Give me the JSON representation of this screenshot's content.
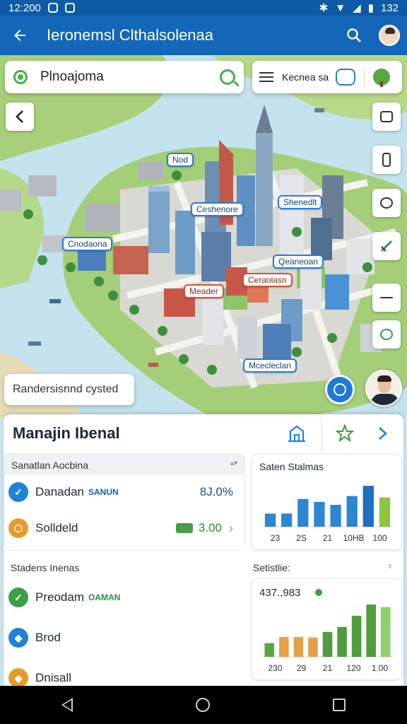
{
  "status_bar": {
    "time": "12:200",
    "battery": "132"
  },
  "app_bar": {
    "title": "Ieronemsl Clthalsolenaa"
  },
  "search": {
    "value": "Plnoajoma"
  },
  "filter": {
    "label": "Kecnea sa"
  },
  "map_labels": [
    "Nod",
    "Ceshenore",
    "Shenedlt",
    "Cnodaona",
    "Qeaneoan",
    "Ceraolasn",
    "Meader",
    "Mcecleclan"
  ],
  "toast": "Randersisnnd cysted",
  "panel": {
    "title": "Manajin Ibenal",
    "section1": {
      "header": "Sanatlan Aocbina",
      "rows": [
        {
          "name": "Danadan",
          "tag": "SANUN",
          "value": "8J.0%"
        },
        {
          "name": "Solldeld",
          "value": "3.00"
        }
      ]
    },
    "section2": {
      "header": "Stadens Inenas",
      "rows": [
        {
          "name": "Preodam",
          "tag": "OAMAN"
        },
        {
          "name": "Brod"
        },
        {
          "name": "Dnisall"
        }
      ]
    }
  },
  "colors": {
    "primary": "#1466b8",
    "accent_green": "#47b04b",
    "bar_blue": "#2d86d2"
  },
  "chart_data": [
    {
      "type": "bar",
      "title": "Saten Stalmas",
      "tick_labels": [
        "23",
        "2S",
        "21",
        "10HB",
        "100"
      ],
      "values": [
        18,
        18,
        38,
        34,
        30,
        42,
        56,
        40
      ],
      "ylim": [
        0,
        60
      ]
    },
    {
      "type": "bar",
      "section_label": "Setistlie:",
      "title": "437.,983",
      "tick_labels": [
        "230",
        "29",
        "21",
        "120",
        "1.00"
      ],
      "values": [
        22,
        32,
        32,
        31,
        40,
        48,
        66,
        84,
        80
      ],
      "ylim": [
        0,
        100
      ]
    }
  ]
}
